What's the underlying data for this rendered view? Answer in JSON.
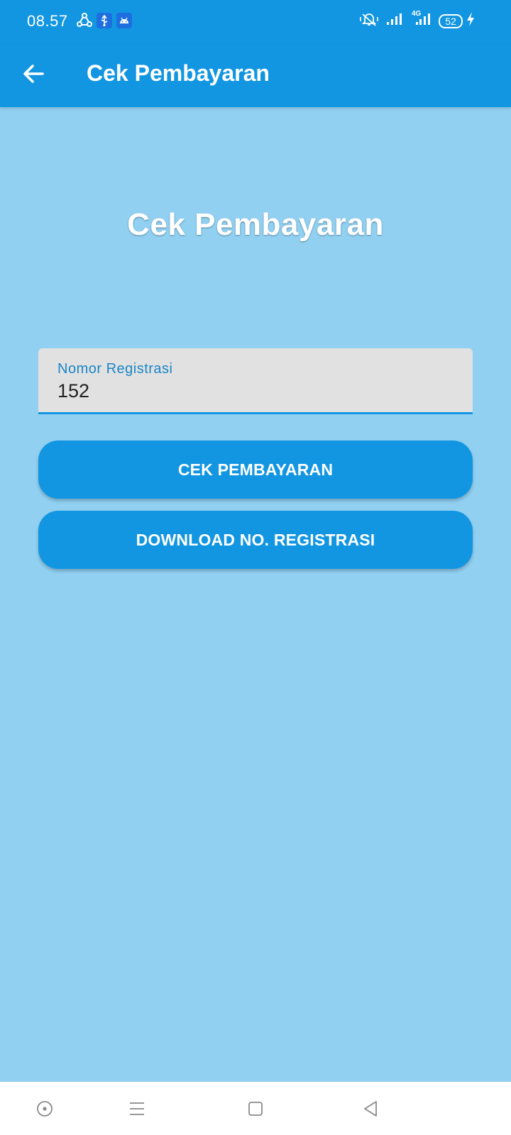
{
  "status_bar": {
    "time": "08.57",
    "battery": "52",
    "network": "4G",
    "notification_icons": [
      "share-icon",
      "usb-icon",
      "android-icon"
    ],
    "system_icons": [
      "vibrate-icon",
      "signal-icon",
      "signal-4g-icon",
      "battery-icon",
      "charging-icon"
    ]
  },
  "app_bar": {
    "title": "Cek Pembayaran",
    "back_icon": "back-arrow-icon"
  },
  "main": {
    "headline": "Cek Pembayaran",
    "registration_field": {
      "label": "Nomor Registrasi",
      "value": "152"
    },
    "buttons": {
      "check_payment": "CEK PEMBAYARAN",
      "download_registration": "DOWNLOAD NO. REGISTRASI"
    }
  },
  "nav_bar": {
    "icons": [
      "assistant-icon",
      "menu-icon",
      "home-square-icon",
      "back-triangle-icon"
    ]
  },
  "colors": {
    "primary": "#1296e2",
    "background": "#91d0f1",
    "field_background": "#e1e1e1",
    "label_accent": "#1a86c7"
  }
}
